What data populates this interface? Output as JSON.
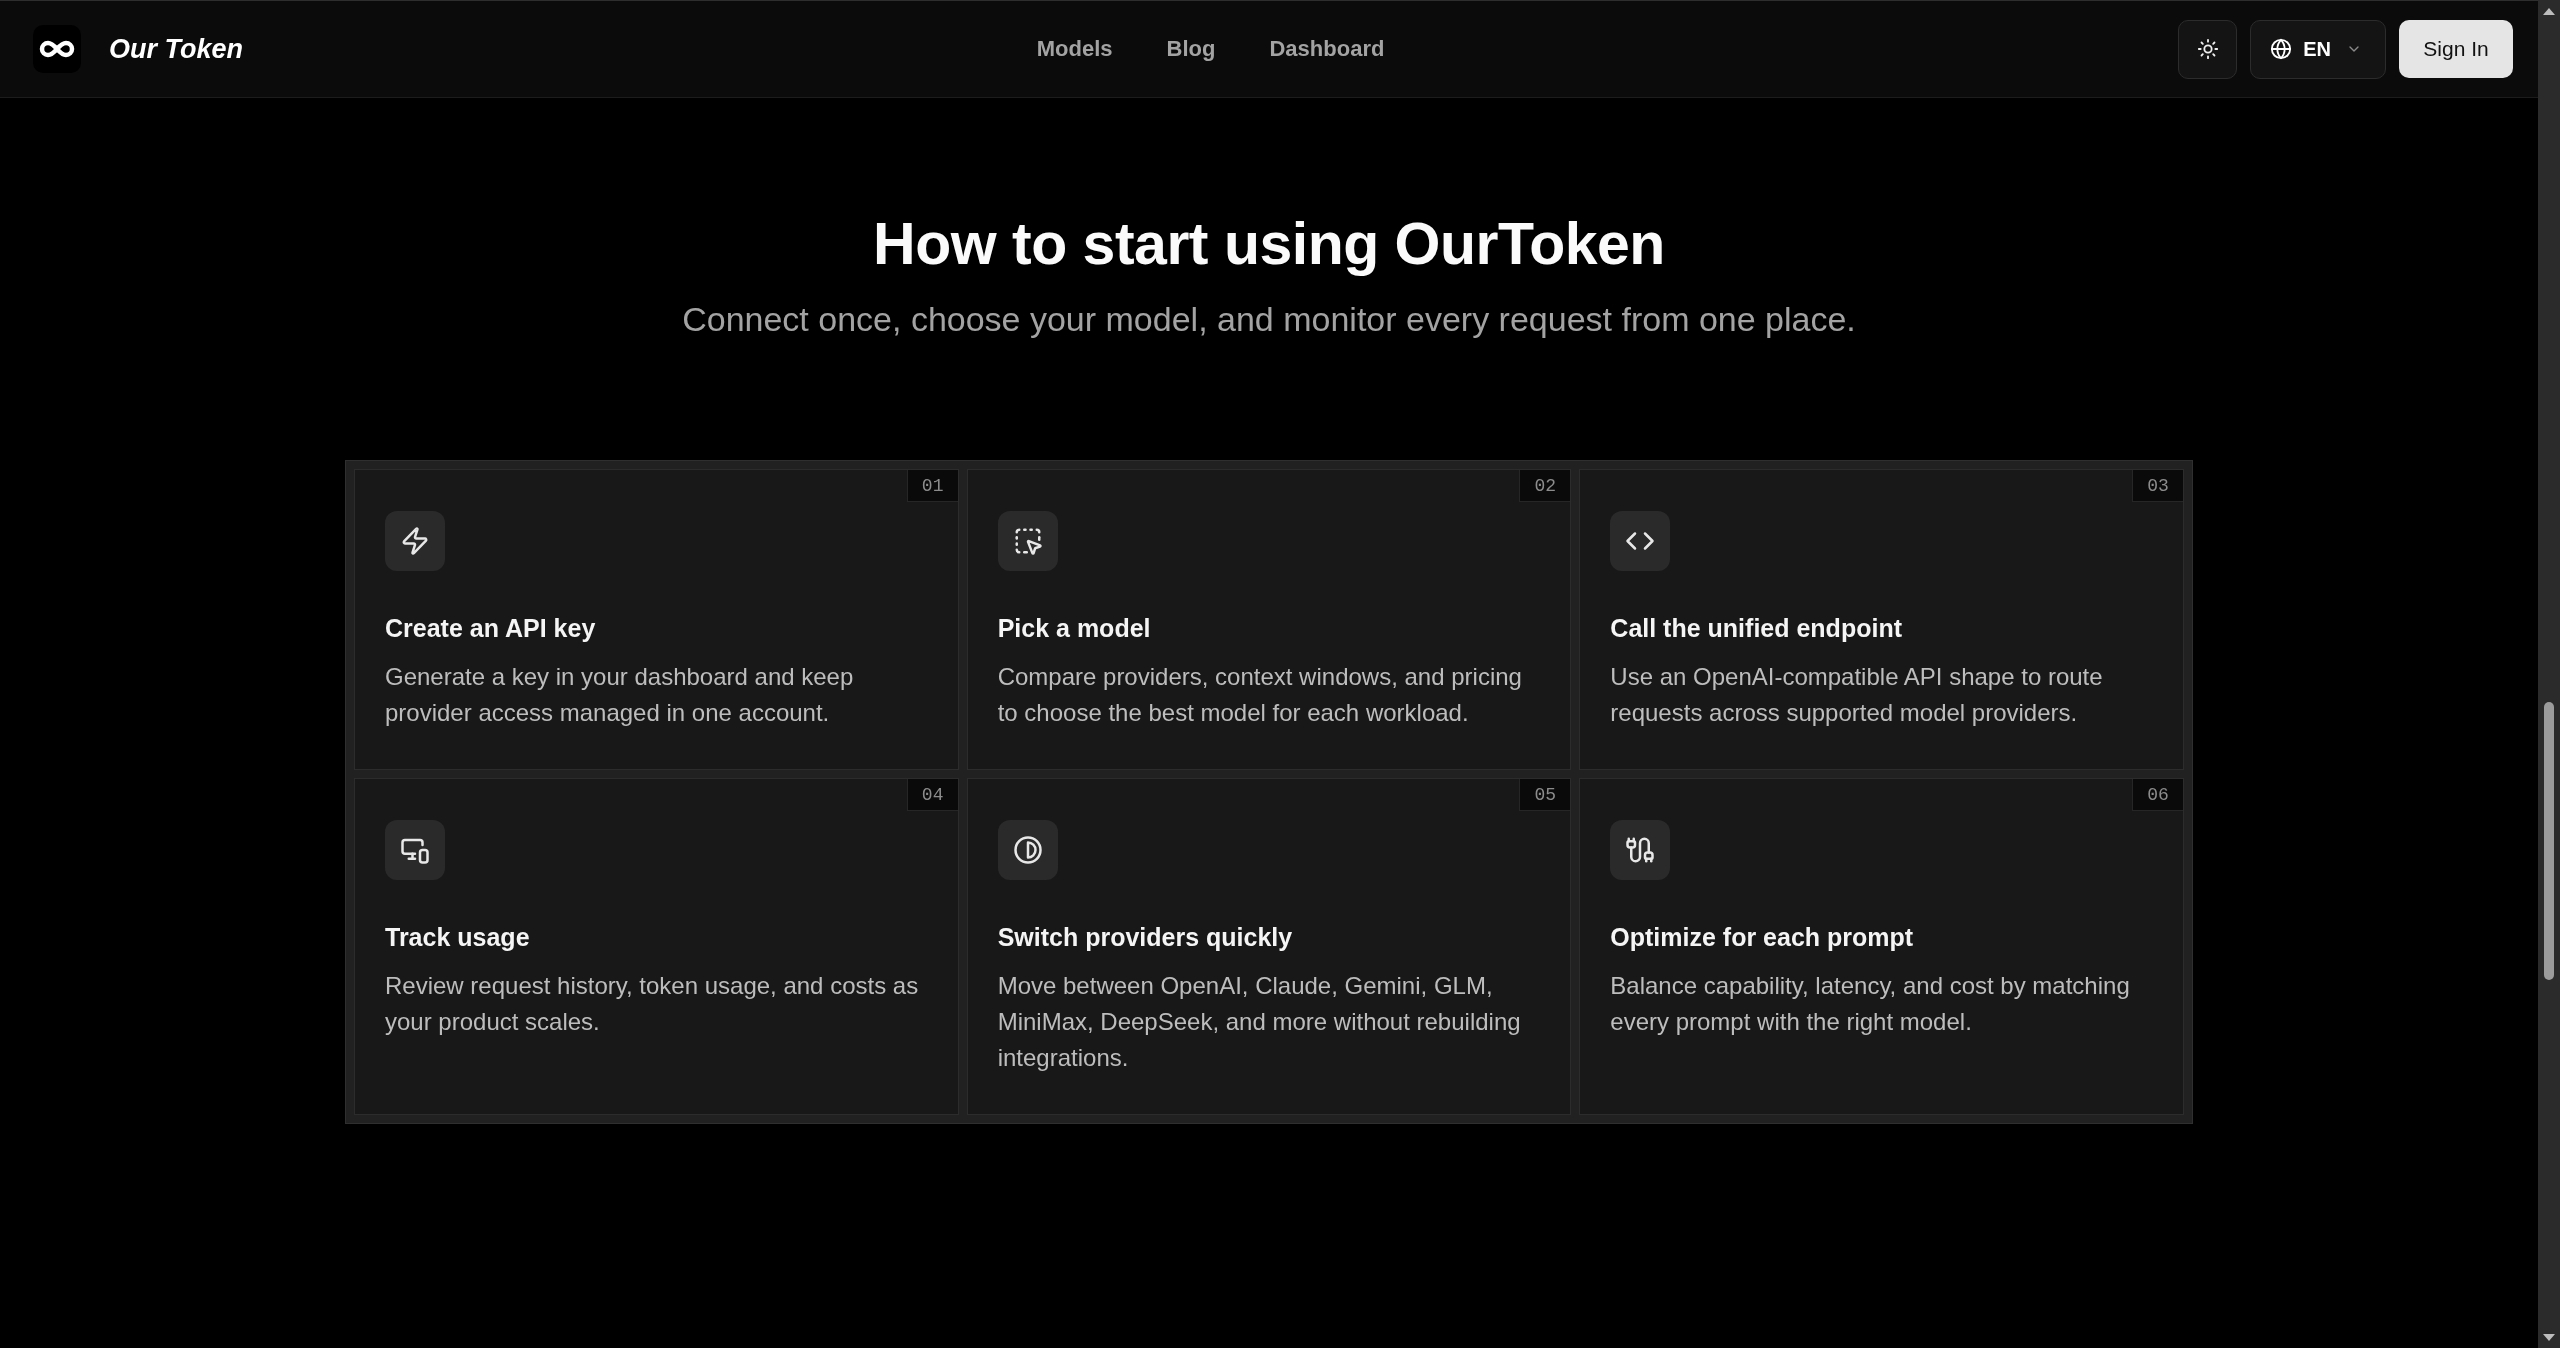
{
  "header": {
    "brand": "Our Token",
    "nav": [
      "Models",
      "Blog",
      "Dashboard"
    ],
    "language": "EN",
    "sign_in": "Sign In"
  },
  "hero": {
    "title": "How to start using OurToken",
    "subtitle": "Connect once, choose your model, and monitor every request from one place."
  },
  "steps": [
    {
      "number": "01",
      "title": "Create an API key",
      "description": "Generate a key in your dashboard and keep provider access managed in one account."
    },
    {
      "number": "02",
      "title": "Pick a model",
      "description": "Compare providers, context windows, and pricing to choose the best model for each workload."
    },
    {
      "number": "03",
      "title": "Call the unified endpoint",
      "description": "Use an OpenAI-compatible API shape to route requests across supported model providers."
    },
    {
      "number": "04",
      "title": "Track usage",
      "description": "Review request history, token usage, and costs as your product scales."
    },
    {
      "number": "05",
      "title": "Switch providers quickly",
      "description": "Move between OpenAI, Claude, Gemini, GLM, MiniMax, DeepSeek, and more without rebuilding integrations."
    },
    {
      "number": "06",
      "title": "Optimize for each prompt",
      "description": "Balance capability, latency, and cost by matching every prompt with the right model."
    }
  ]
}
